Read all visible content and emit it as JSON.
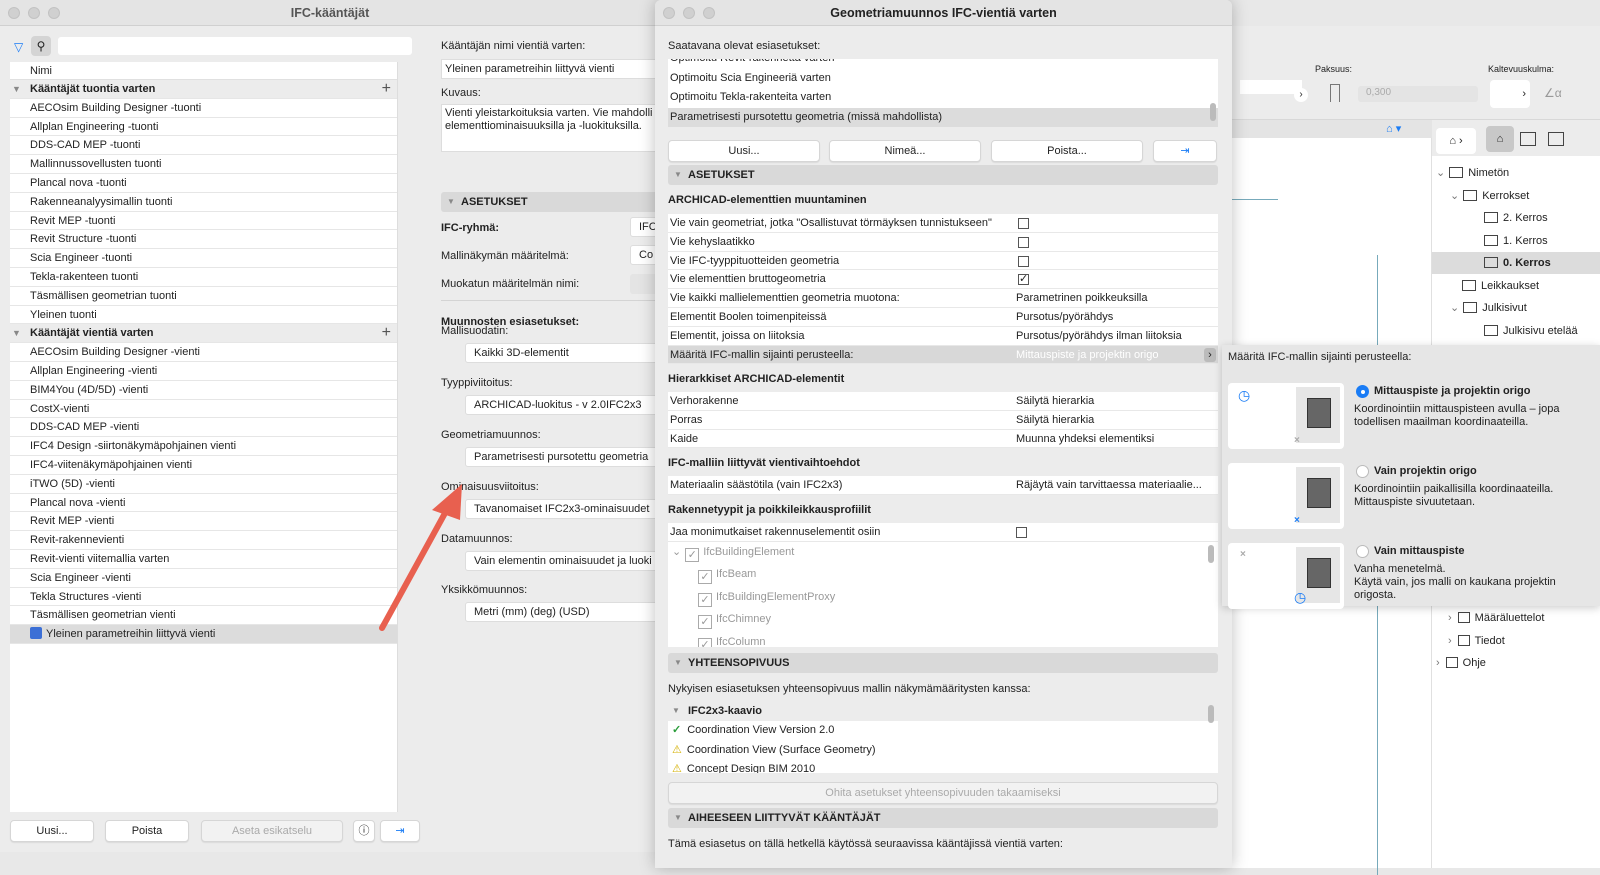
{
  "translators_window": {
    "title": "IFC-kääntäjät",
    "search_placeholder": "",
    "column_name": "Nimi",
    "import_group": "Kääntäjät tuontia varten",
    "import_items": [
      "AECOsim Building Designer -tuonti",
      "Allplan Engineering -tuonti",
      "DDS-CAD MEP -tuonti",
      "Mallinnussovellusten tuonti",
      "Plancal nova -tuonti",
      "Rakenneanalyysimallin tuonti",
      "Revit MEP -tuonti",
      "Revit Structure -tuonti",
      "Scia Engineer -tuonti",
      "Tekla-rakenteen tuonti",
      "Täsmällisen geometrian tuonti",
      "Yleinen tuonti"
    ],
    "export_group": "Kääntäjät vientiä varten",
    "export_items": [
      "AECOsim Building Designer -vienti",
      "Allplan Engineering -vienti",
      "BIM4You (4D/5D) -vienti",
      "CostX-vienti",
      "DDS-CAD MEP -vienti",
      "IFC4 Design -siirtonäkymäpohjainen vienti",
      "IFC4-viitenäkymäpohjainen vienti",
      "iTWO (5D) -vienti",
      "Plancal nova -vienti",
      "Revit MEP -vienti",
      "Revit-rakennevienti",
      "Revit-vienti viitemallia varten",
      "Scia Engineer -vienti",
      "Tekla Structures -vienti",
      "Täsmällisen geometrian vienti",
      "Yleinen parametreihin liittyvä vienti"
    ],
    "selected_export": "Yleinen parametreihin liittyvä vienti",
    "buttons": {
      "new": "Uusi...",
      "delete": "Poista",
      "set_preview": "Aseta esikatselu"
    },
    "details": {
      "name_label": "Kääntäjän nimi vientiä varten:",
      "name_value": "Yleinen parametreihin liittyvä vienti",
      "desc_label": "Kuvaus:",
      "desc_value": "Vienti yleistarkoituksia varten. Vie mahdolli elementtiominaisuuksilla ja -luokituksilla.",
      "settings_header": "ASETUKSET",
      "ifc_group_label": "IFC-ryhmä:",
      "ifc_group_value": "IFC",
      "mvd_label": "Mallinäkymän määritelmä:",
      "mvd_value": "Co",
      "custom_mvd_label": "Muokatun määritelmän nimi:",
      "presets_header": "Muunnosten esiasetukset:",
      "model_filter_label": "Mallisuodatin:",
      "model_filter_value": "Kaikki 3D-elementit",
      "type_mapping_label": "Tyyppiviitoitus:",
      "type_mapping_value": "ARCHICAD-luokitus - v 2.0IFC2x3",
      "geometry_label": "Geometriamuunnos:",
      "geometry_value": "Parametrisesti pursotettu geometria",
      "property_label": "Ominaisuusviitoitus:",
      "property_value": "Tavanomaiset IFC2x3-ominaisuudet",
      "data_label": "Datamuunnos:",
      "data_value": "Vain elementin ominaisuudet ja luoki",
      "unit_label": "Yksikkömuunnos:",
      "unit_value": "Metri (mm) (deg) (USD)"
    }
  },
  "dialog": {
    "title": "Geometriamuunnos IFC-vientiä varten",
    "presets_label": "Saatavana olevat esiasetukset:",
    "presets": [
      "Optimoitu Revit-rakennetta varten",
      "Optimoitu Scia Engineeriä varten",
      "Optimoitu Tekla-rakenteita varten",
      "Parametrisesti pursotettu geometria (missä mahdollista)"
    ],
    "buttons": {
      "new": "Uusi...",
      "rename": "Nimeä...",
      "delete": "Poista..."
    },
    "settings_header": "ASETUKSET",
    "conv_header": "ARCHICAD-elementtien muuntaminen",
    "conv_rows": [
      {
        "label": "Vie vain geometriat, jotka \"Osallistuvat törmäyksen tunnistukseen\"",
        "checked": false
      },
      {
        "label": "Vie kehyslaatikko",
        "checked": false
      },
      {
        "label": "Vie IFC-tyyppituotteiden geometria",
        "checked": false
      },
      {
        "label": "Vie elementtien bruttogeometria",
        "checked": true
      }
    ],
    "value_rows": [
      {
        "label": "Vie kaikki mallielementtien geometria muotona:",
        "value": "Parametrinen poikkeuksilla"
      },
      {
        "label": "Elementit Boolen toimenpiteissä",
        "value": "Pursotus/pyörähdys"
      },
      {
        "label": "Elementit, joissa on liitoksia",
        "value": "Pursotus/pyörähdys ilman liitoksia"
      }
    ],
    "location_row": {
      "label": "Määritä IFC-mallin sijainti perusteella:",
      "value": "Mittauspiste ja projektin origo"
    },
    "hier_header": "Hierarkkiset ARCHICAD-elementit",
    "hier_rows": [
      {
        "label": "Verhorakenne",
        "value": "Säilytä hierarkia"
      },
      {
        "label": "Porras",
        "value": "Säilytä hierarkia"
      },
      {
        "label": "Kaide",
        "value": "Muunna yhdeksi elementiksi"
      }
    ],
    "ifc_opt_header": "IFC-malliin liittyvät vientivaihtoehdot",
    "ifc_opt_rows": [
      {
        "label": "Materiaalin säästötila (vain IFC2x3)",
        "value": "Räjäytä vain tarvittaessa materiaalie..."
      }
    ],
    "struct_header": "Rakennetyypit ja poikkileikkausprofiilit",
    "split_label": "Jaa monimutkaiset rakennuselementit osiin",
    "split_checked": false,
    "ifc_tree_root": "IfcBuildingElement",
    "ifc_tree_items": [
      "IfcBeam",
      "IfcBuildingElementProxy",
      "IfcChimney",
      "IfcColumn"
    ],
    "compat_header": "YHTEENSOPIVUUS",
    "compat_label": "Nykyisen esiasetuksen yhteensopivuus mallin näkymämääritysten kanssa:",
    "compat_group": "IFC2x3-kaavio",
    "compat_items": [
      {
        "label": "Coordination View Version 2.0",
        "status": "ok"
      },
      {
        "label": "Coordination View (Surface Geometry)",
        "status": "warning"
      },
      {
        "label": "Concept Design BIM 2010",
        "status": "warning"
      }
    ],
    "override_button": "Ohita asetukset yhteensopivuuden takaamiseksi",
    "related_header": "AIHEESEEN LIITTYVÄT KÄÄNTÄJÄT",
    "related_label": "Tämä esiasetus on tällä hetkellä käytössä seuraavissa kääntäjissä vientiä varten:"
  },
  "popover": {
    "title": "Määritä IFC-mallin sijainti perusteella:",
    "options": [
      {
        "title": "Mittauspiste ja projektin origo",
        "desc": "Koordinointiin mittauspisteen avulla – jopa todellisen maailman koordinaateilla.",
        "selected": true
      },
      {
        "title": "Vain projektin origo",
        "desc": "Koordinointiin paikallisilla koordinaateilla. Mittauspiste sivuutetaan.",
        "selected": false
      },
      {
        "title": "Vain mittauspiste",
        "desc": "Vanha menetelmä.\nKäytä vain, jos malli on kaukana projektin origosta.",
        "selected": false
      }
    ]
  },
  "archicad": {
    "thickness_label": "Paksuus:",
    "thickness_value": "0,300",
    "slope_label": "Kaltevuuskulma:",
    "navigator": [
      {
        "label": "Nimetön",
        "level": 0
      },
      {
        "label": "Kerrokset",
        "level": 1
      },
      {
        "label": "2. Kerros",
        "level": 2
      },
      {
        "label": "1. Kerros",
        "level": 2
      },
      {
        "label": "0. Kerros",
        "level": 2,
        "selected": true
      },
      {
        "label": "Leikkaukset",
        "level": 1
      },
      {
        "label": "Julkisivut",
        "level": 1
      },
      {
        "label": "Julkisivu etelää",
        "level": 2
      }
    ],
    "navigator_bottom": [
      "Määräluettelot",
      "Tiedot",
      "Ohje"
    ]
  },
  "colors": {
    "accent": "#1a7cf5",
    "arrow": "#e8604f",
    "ok": "#2a9d3a",
    "warning": "#f2d21b"
  }
}
